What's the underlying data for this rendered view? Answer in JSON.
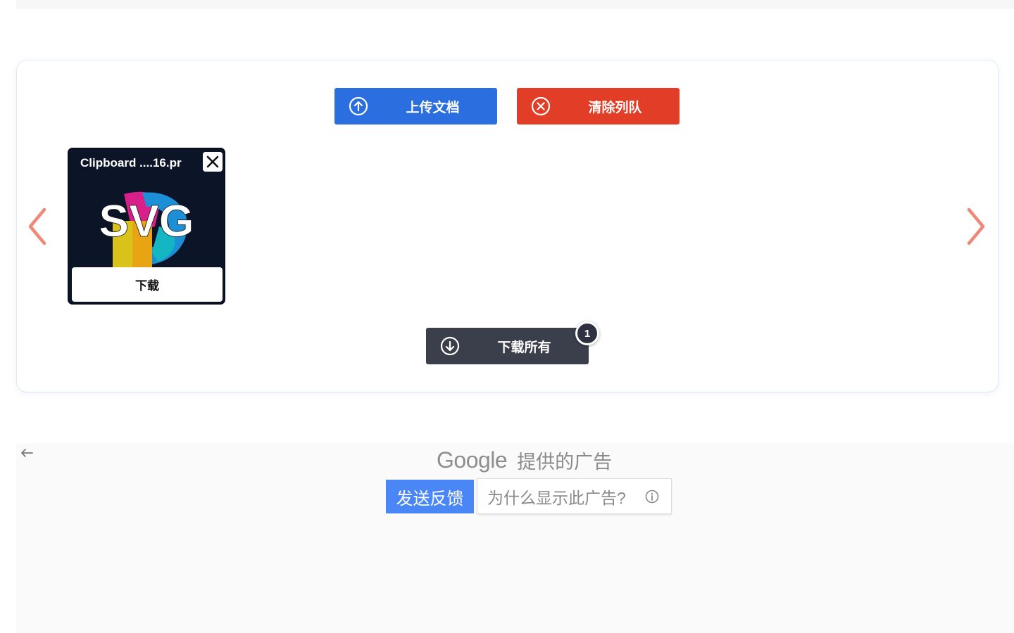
{
  "toolbar": {
    "upload_label": "上传文档",
    "clear_label": "清除列队",
    "download_all_label": "下载所有",
    "queue_count": "1"
  },
  "files": [
    {
      "name": "Clipboard ....16.pr",
      "thumb_text": "SVG",
      "download_label": "下载"
    }
  ],
  "ad": {
    "google_logo": "Google",
    "provided_by": "提供的广告",
    "feedback_label": "发送反馈",
    "why_label": "为什么显示此广告?"
  },
  "colors": {
    "upload": "#2a6ee0",
    "clear": "#e23d26",
    "download_all": "#3a3f4b",
    "nav_arrow": "#f08878",
    "feedback": "#4a86f5"
  },
  "icons": {
    "upload": "arrow-up-circle-icon",
    "clear": "x-circle-icon",
    "download_all": "arrow-down-circle-icon",
    "prev": "chevron-left-icon",
    "next": "chevron-right-icon",
    "close": "close-icon",
    "back": "arrow-left-icon",
    "info": "info-icon"
  }
}
